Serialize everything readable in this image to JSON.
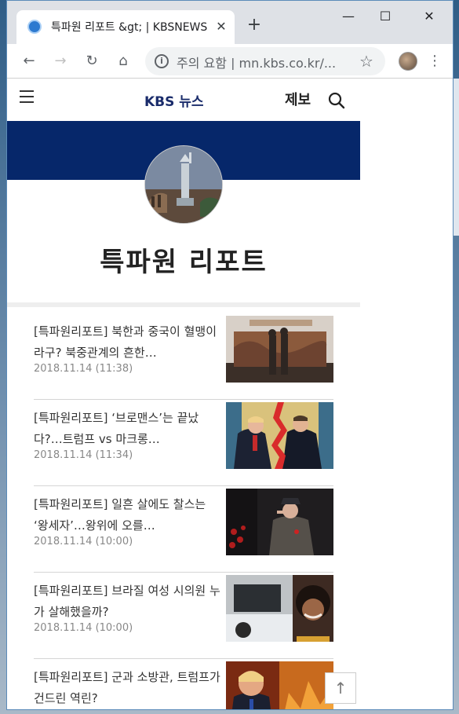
{
  "browser": {
    "tab_title": "특파원 리포트 &gt; | KBSNEWS",
    "new_tab": "+",
    "close_tab": "✕",
    "minimize": "—",
    "maximize": "☐",
    "close_window": "✕",
    "omnibox": {
      "security_label": "주의 요함",
      "url": "mn.kbs.co.kr/..."
    },
    "nav": {
      "back": "←",
      "forward": "→",
      "reload": "↻",
      "home": "⌂",
      "star": "☆",
      "menu": "⋮"
    }
  },
  "site": {
    "logo": "KBS 뉴스",
    "tipoff": "제보",
    "section_title": "특파원 리포트",
    "banner_color": "#06276a",
    "scroll_top": "↑"
  },
  "articles": [
    {
      "title": "[특파원리포트] 북한과 중국이 혈맹이라구? 북중관계의 흔한…",
      "date": "2018.11.14 (11:38)",
      "thumb_icon": "statue-monument-photo"
    },
    {
      "title": "[특파원리포트] ‘브로맨스’는 끝났다?…트럼프 vs 마크롱…",
      "date": "2018.11.14 (11:34)",
      "thumb_icon": "two-leaders-photo"
    },
    {
      "title": "[특파원리포트] 일흔 살에도 찰스는 ‘왕세자’…왕위에 오를…",
      "date": "2018.11.14 (10:00)",
      "thumb_icon": "prince-salute-photo"
    },
    {
      "title": "[특파원리포트] 브라질 여성 시의원 누가 살해했을까?",
      "date": "2018.11.14 (10:00)",
      "thumb_icon": "car-woman-photo"
    },
    {
      "title": "[특파원리포트] 군과 소방관, 트럼프가 건드린 역린?",
      "date": "",
      "thumb_icon": "fire-trump-photo"
    }
  ]
}
